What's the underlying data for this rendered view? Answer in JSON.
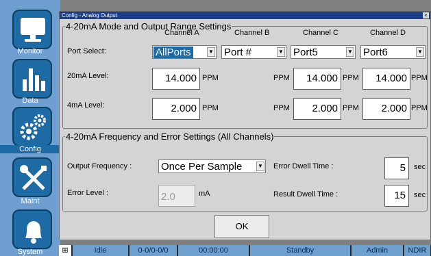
{
  "nav": {
    "items": [
      {
        "label": "Monitor",
        "icon": "monitor-icon"
      },
      {
        "label": "Data",
        "icon": "bar-chart-icon"
      },
      {
        "label": "Config",
        "icon": "gears-icon",
        "active": true
      },
      {
        "label": "Maint",
        "icon": "wrench-screwdriver-icon"
      },
      {
        "label": "System",
        "icon": "bell-icon"
      }
    ]
  },
  "dialog": {
    "title": "Config - Analog Output",
    "close": "×",
    "range_group": {
      "legend": "4-20mA Mode and Output Range Settings",
      "channels": [
        "Channel A",
        "Channel B",
        "Channel C",
        "Channel D"
      ],
      "port_select_label": "Port Select:",
      "ports": [
        "AllPorts",
        "Port #",
        "Port5",
        "Port6"
      ],
      "level20_label": "20mA Level:",
      "level4_label": "4mA Level:",
      "unit": "PPM",
      "level20": {
        "a": "14.000",
        "c": "14.000",
        "d": "14.000"
      },
      "level4": {
        "a": "2.000",
        "c": "2.000",
        "d": "2.000"
      }
    },
    "freq_group": {
      "legend": "4-20mA Frequency and Error Settings (All Channels)",
      "output_frequency_label": "Output Frequency :",
      "output_frequency": "Once Per Sample",
      "error_level_label": "Error Level :",
      "error_level": "2.0",
      "error_level_unit": "mA",
      "error_dwell_label": "Error Dwell Time :",
      "error_dwell": "5",
      "result_dwell_label": "Result Dwell Time :",
      "result_dwell": "15",
      "sec": "sec"
    },
    "ok_label": "OK"
  },
  "status": {
    "icon": "network-icon",
    "state": "Idle",
    "counter": "0-0/0-0/0",
    "time": "00:00:00",
    "mode": "Standby",
    "user": "Admin",
    "sensor": "NDIR"
  },
  "colors": {
    "accent": "#1d6aa5",
    "titlebar": "#1d3f8a",
    "nav_bg": "#6f9fd0"
  }
}
